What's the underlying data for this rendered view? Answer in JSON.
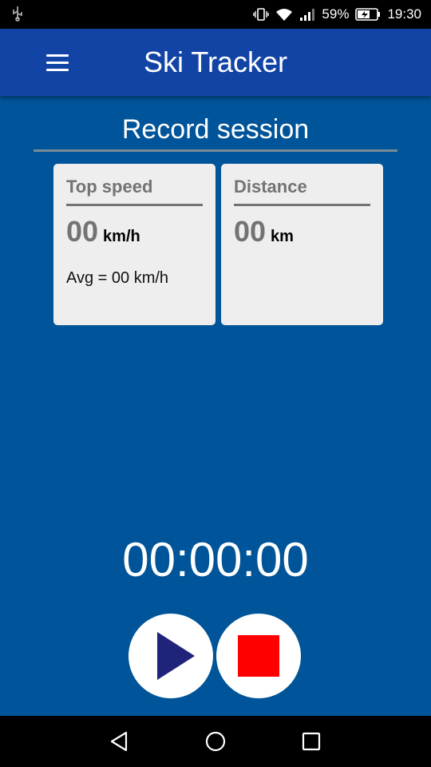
{
  "status_bar": {
    "battery_percent": "59%",
    "time": "19:30",
    "icons": [
      "usb-icon",
      "vibrate-icon",
      "wifi-icon",
      "signal-icon",
      "battery-charging-icon"
    ]
  },
  "app_bar": {
    "title": "Ski Tracker",
    "menu_icon": "hamburger-menu-icon"
  },
  "section": {
    "title": "Record session"
  },
  "cards": {
    "speed": {
      "label": "Top speed",
      "value": "00",
      "unit": "km/h",
      "avg": "Avg = 00 km/h"
    },
    "distance": {
      "label": "Distance",
      "value": "00",
      "unit": "km"
    }
  },
  "timer": {
    "value": "00:00:00"
  },
  "controls": {
    "play_icon": "play-icon",
    "stop_icon": "stop-icon",
    "play_color": "#1f237a",
    "stop_color": "#ff0000"
  },
  "nav_bar": {
    "icons": [
      "back-icon",
      "home-icon",
      "recents-icon"
    ]
  },
  "colors": {
    "background": "#005499",
    "app_bar": "#1244a6",
    "card": "#eeeeee"
  }
}
